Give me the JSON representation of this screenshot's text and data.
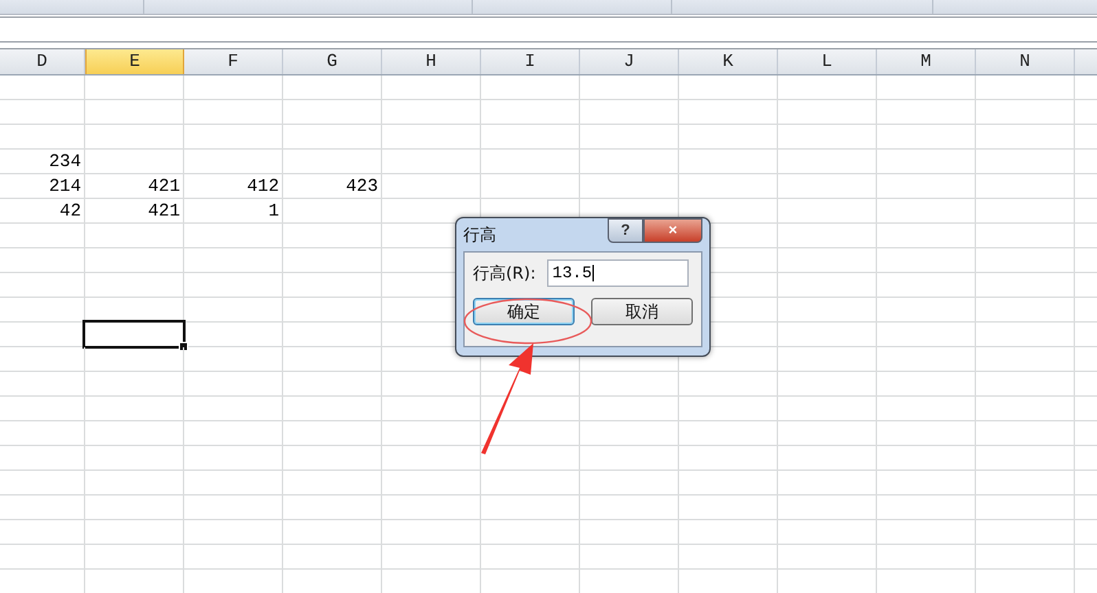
{
  "columns": [
    {
      "label": "D",
      "selected": false
    },
    {
      "label": "E",
      "selected": true
    },
    {
      "label": "F",
      "selected": false
    },
    {
      "label": "G",
      "selected": false
    },
    {
      "label": "H",
      "selected": false
    },
    {
      "label": "I",
      "selected": false
    },
    {
      "label": "J",
      "selected": false
    },
    {
      "label": "K",
      "selected": false
    },
    {
      "label": "L",
      "selected": false
    },
    {
      "label": "M",
      "selected": false
    },
    {
      "label": "N",
      "selected": false
    }
  ],
  "rows": [
    {
      "selected": false
    },
    {
      "selected": false
    },
    {
      "selected": false
    },
    {
      "selected": false,
      "cells": {
        "D": "234"
      }
    },
    {
      "selected": false,
      "cells": {
        "D": "214",
        "E": "421",
        "F": "412",
        "G": "423"
      }
    },
    {
      "selected": false,
      "cells": {
        "D": "42",
        "E": "421",
        "F": "1"
      }
    },
    {
      "selected": false
    },
    {
      "selected": false
    },
    {
      "selected": false
    },
    {
      "selected": false
    },
    {
      "selected": true
    },
    {
      "selected": false
    },
    {
      "selected": false
    },
    {
      "selected": false
    },
    {
      "selected": false
    },
    {
      "selected": false
    },
    {
      "selected": false
    },
    {
      "selected": false
    },
    {
      "selected": false
    },
    {
      "selected": false
    },
    {
      "selected": false
    }
  ],
  "dialog": {
    "title": "行高",
    "help": "?",
    "close": "×",
    "label": "行高(R):",
    "value": "13.5",
    "buttons": [
      {
        "label": "确定",
        "focused": true
      },
      {
        "label": "取消",
        "focused": false
      }
    ]
  }
}
